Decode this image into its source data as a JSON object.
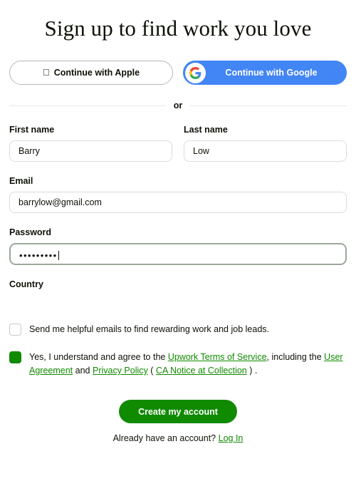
{
  "page": {
    "title": "Sign up to find work you love"
  },
  "social": {
    "apple": {
      "label": "Continue with Apple",
      "icon": "apple-logo-icon"
    },
    "google": {
      "label": "Continue with Google",
      "icon": "google-logo-icon",
      "color": "#4285f4"
    }
  },
  "divider": {
    "text": "or"
  },
  "form": {
    "first_name": {
      "label": "First name",
      "value": "Barry",
      "placeholder": ""
    },
    "last_name": {
      "label": "Last name",
      "value": "Low",
      "placeholder": ""
    },
    "email": {
      "label": "Email",
      "value": "barrylow@gmail.com",
      "placeholder": ""
    },
    "password": {
      "label": "Password",
      "value": "•••••••••",
      "placeholder": ""
    },
    "country": {
      "label": "Country",
      "value": "",
      "placeholder": ""
    }
  },
  "consents": {
    "marketing": {
      "label": "Send me helpful emails to find rewarding work and job leads.",
      "checked": false
    },
    "terms": {
      "checked": true,
      "text_1": "Yes, I understand and agree to the",
      "link_1": "Upwork Terms of Service",
      "text_2": ", including the",
      "link_2": "User Agreement",
      "text_3": "and",
      "link_3": "Privacy Policy",
      "text_4": "(",
      "link_4": "CA Notice at Collection",
      "text_5": ")",
      "text_6": "."
    }
  },
  "actions": {
    "submit_label": "Create my account",
    "submit_color": "#108a00",
    "login_prompt": "Already have an account?",
    "login_link": "Log In"
  }
}
